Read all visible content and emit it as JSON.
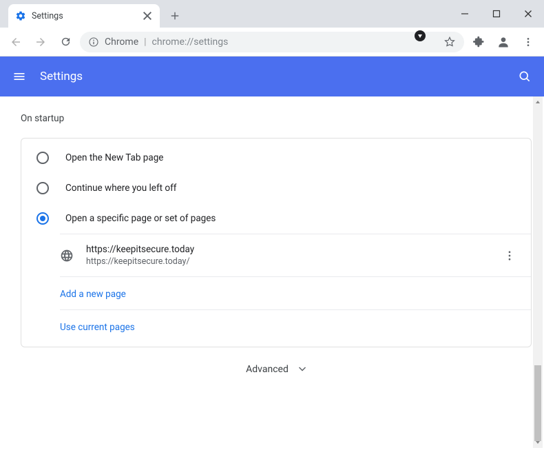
{
  "window": {
    "title": "Settings"
  },
  "tab": {
    "title": "Settings"
  },
  "addr": {
    "scheme_label": "Chrome",
    "url": "chrome://settings"
  },
  "header": {
    "title": "Settings"
  },
  "section": {
    "title": "On startup"
  },
  "options": {
    "new_tab": "Open the New Tab page",
    "continue": "Continue where you left off",
    "specific": "Open a specific page or set of pages"
  },
  "startup_page": {
    "title": "https://keepitsecure.today",
    "url": "https://keepitsecure.today/"
  },
  "links": {
    "add_page": "Add a new page",
    "use_current": "Use current pages"
  },
  "footer": {
    "advanced": "Advanced"
  }
}
